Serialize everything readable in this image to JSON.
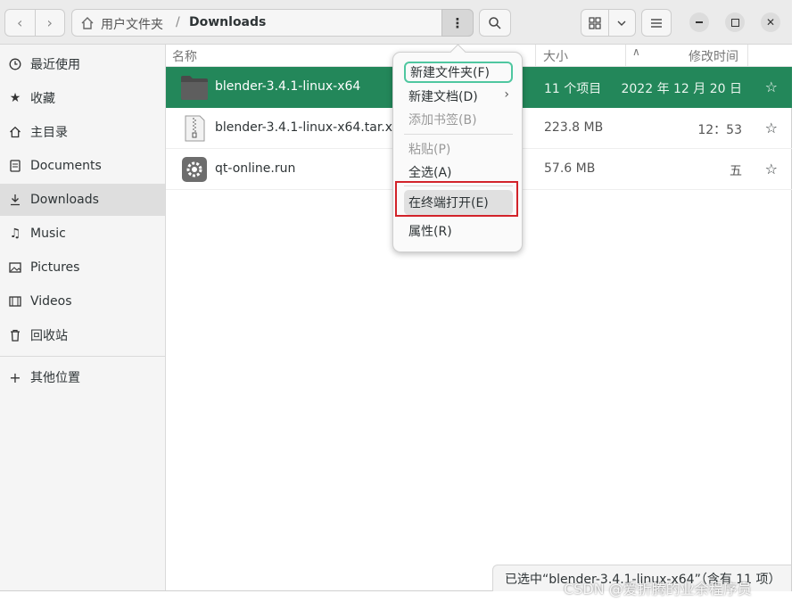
{
  "header": {
    "path_parent": "用户文件夹",
    "path_separator": "/",
    "path_current": "Downloads"
  },
  "sidebar": {
    "items": [
      {
        "label": "最近使用",
        "icon": "clock-icon"
      },
      {
        "label": "收藏",
        "icon": "star-icon"
      },
      {
        "label": "主目录",
        "icon": "home-icon"
      },
      {
        "label": "Documents",
        "icon": "document-icon"
      },
      {
        "label": "Downloads",
        "icon": "download-icon"
      },
      {
        "label": "Music",
        "icon": "music-icon"
      },
      {
        "label": "Pictures",
        "icon": "picture-icon"
      },
      {
        "label": "Videos",
        "icon": "video-icon"
      },
      {
        "label": "回收站",
        "icon": "trash-icon"
      },
      {
        "label": "其他位置",
        "icon": "plus-icon"
      }
    ]
  },
  "columns": {
    "name": "名称",
    "size": "大小",
    "modified": "修改时间"
  },
  "files": [
    {
      "name": "blender-3.4.1-linux-x64",
      "size": "11 个项目",
      "modified": "2022 年 12 月 20 日",
      "icon": "folder-icon",
      "selected": true
    },
    {
      "name": "blender-3.4.1-linux-x64.tar.xz",
      "size": "223.8 MB",
      "modified": "12：53",
      "icon": "archive-icon",
      "selected": false
    },
    {
      "name": "qt-online.run",
      "size": "57.6 MB",
      "modified": "五",
      "icon": "executable-icon",
      "selected": false
    }
  ],
  "context_menu": {
    "new_folder": "新建文件夹(F)",
    "new_document": "新建文档(D)",
    "add_bookmark": "添加书签(B)",
    "paste": "粘贴(P)",
    "select_all": "全选(A)",
    "open_terminal": "在终端打开(E)",
    "properties": "属性(R)"
  },
  "status": {
    "text": "已选中“blender-3.4.1-linux-x64”（含有 11 项）"
  },
  "watermark": "CSDN @爱折腾的业余程序员",
  "colors": {
    "selection": "#23875a",
    "highlight_box": "#d2232a",
    "focus_ring": "#4fc7a0"
  }
}
